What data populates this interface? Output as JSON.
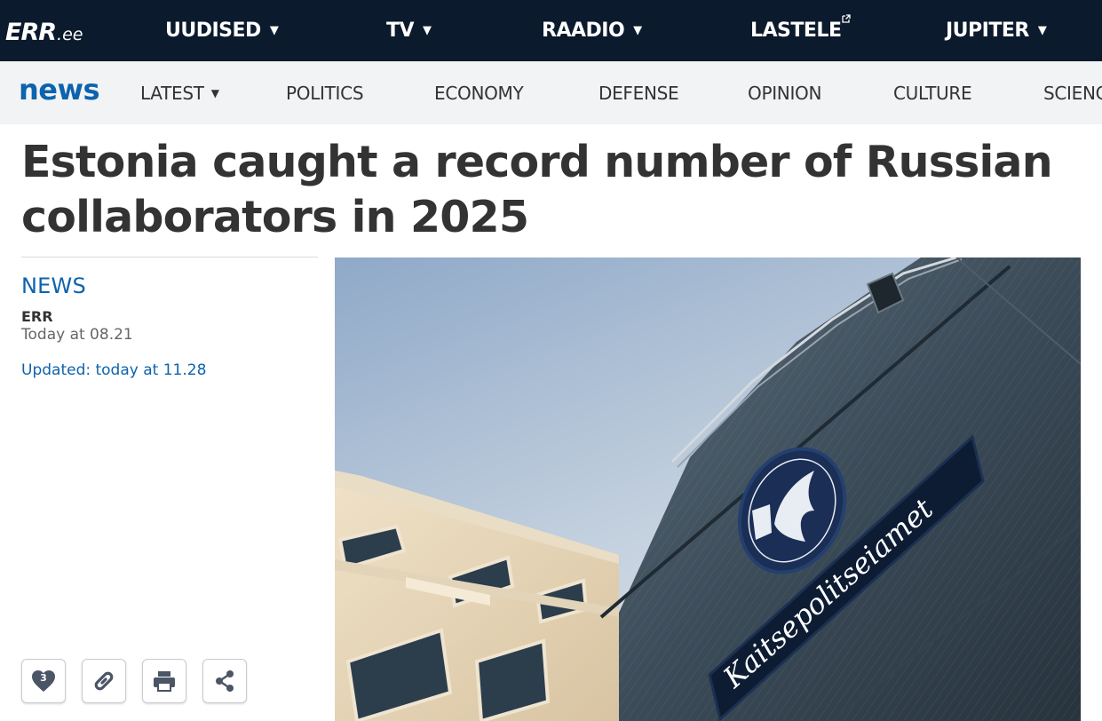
{
  "topbar": {
    "logo": {
      "err": "ERR",
      "ee": ".ee"
    },
    "items": [
      {
        "label": "UUDISED",
        "caret": "▼"
      },
      {
        "label": "TV",
        "caret": "▼"
      },
      {
        "label": "RAADIO",
        "caret": "▼"
      },
      {
        "label": "LASTELE",
        "external": true
      },
      {
        "label": "JUPITER",
        "caret": "▼"
      }
    ]
  },
  "subnav": {
    "brand": "news",
    "items": [
      {
        "label": "LATEST",
        "caret": "▼"
      },
      {
        "label": "POLITICS"
      },
      {
        "label": "ECONOMY"
      },
      {
        "label": "DEFENSE"
      },
      {
        "label": "OPINION"
      },
      {
        "label": "CULTURE"
      },
      {
        "label": "SCIENCE"
      }
    ]
  },
  "article": {
    "headline": "Estonia caught a record number of Russian collaborators in 2025",
    "category": "NEWS",
    "author": "ERR",
    "published": "Today at 08.21",
    "updated": "Updated: today at 11.28",
    "like_count": "3",
    "image": {
      "sign_text": "Kaitsepolitseiamet"
    }
  },
  "icons": {
    "like": "heart-icon",
    "copy_link": "link-icon",
    "print": "printer-icon",
    "share": "share-icon",
    "external": "external-link-icon"
  },
  "colors": {
    "topbar_bg": "#0b1a2c",
    "subnav_bg": "#f2f3f5",
    "accent": "#0d63ad",
    "text": "#333333"
  }
}
